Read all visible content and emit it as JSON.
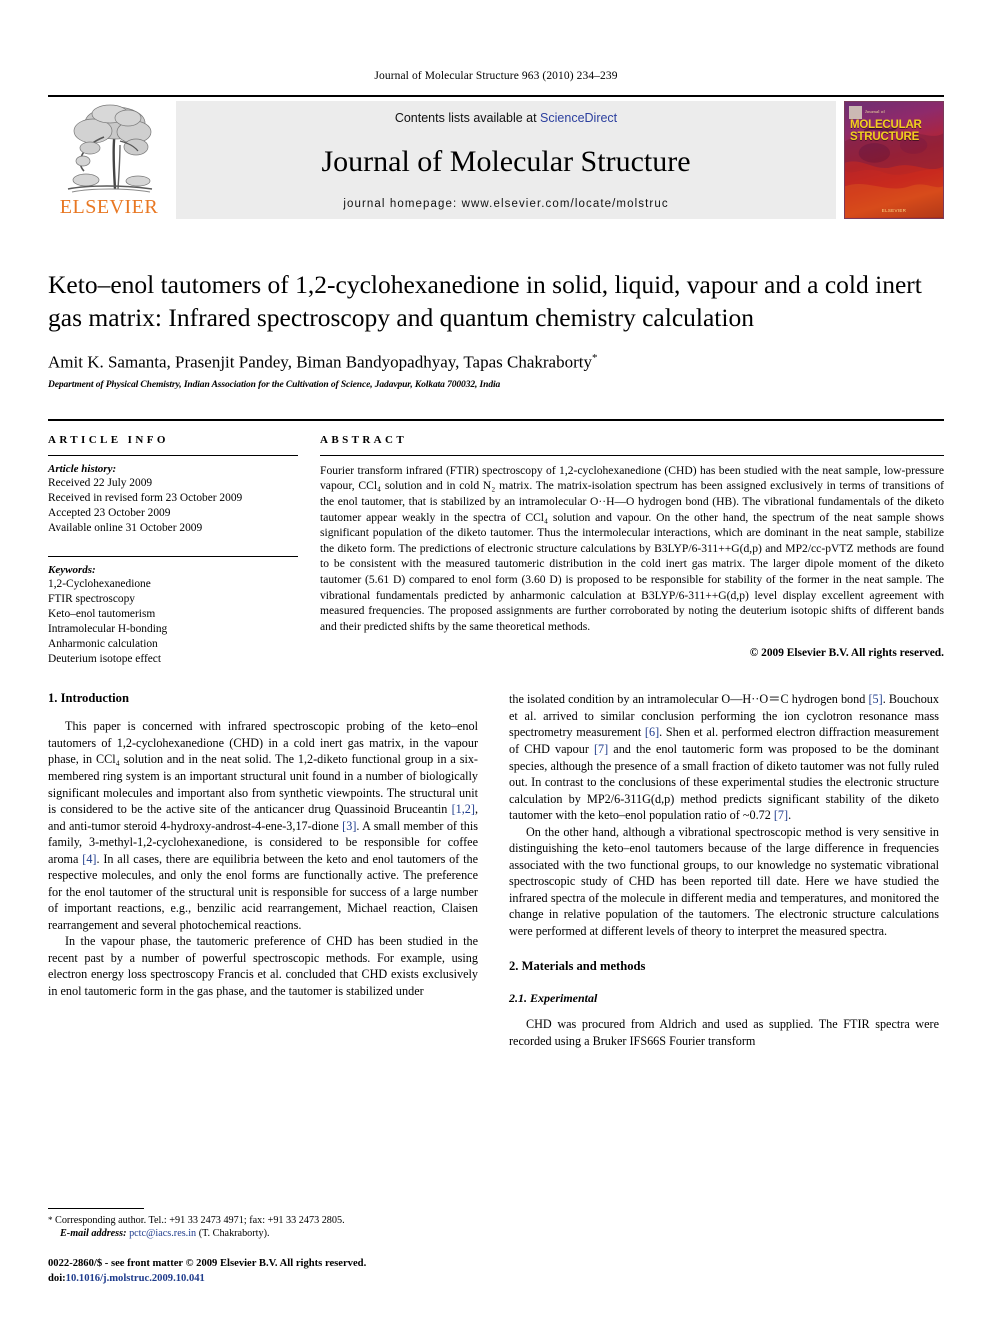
{
  "running_head": "Journal of Molecular Structure 963 (2010) 234–239",
  "masthead": {
    "contents_prefix": "Contents lists available at ",
    "sciencedirect": "ScienceDirect",
    "journal_title": "Journal of Molecular Structure",
    "homepage": "journal homepage: www.elsevier.com/locate/molstruc",
    "publisher_logo_text": "ELSEVIER",
    "cover": {
      "top_label": "Journal of",
      "title_line1": "MOLECULAR",
      "title_line2": "STRUCTURE",
      "bottom_label": "ELSEVIER"
    },
    "link_color": "#2b3f9e",
    "brand_color": "#E87722"
  },
  "article": {
    "title": "Keto–enol tautomers of 1,2-cyclohexanedione in solid, liquid, vapour and a cold inert gas matrix: Infrared spectroscopy and quantum chemistry calculation",
    "authors": "Amit K. Samanta, Prasenjit Pandey, Biman Bandyopadhyay, Tapas Chakraborty",
    "author_marker": "*",
    "affiliation": "Department of Physical Chemistry, Indian Association for the Cultivation of Science, Jadavpur, Kolkata 700032, India"
  },
  "article_info": {
    "heading": "ARTICLE INFO",
    "history_label": "Article history:",
    "history": [
      "Received 22 July 2009",
      "Received in revised form 23 October 2009",
      "Accepted 23 October 2009",
      "Available online 31 October 2009"
    ],
    "keywords_label": "Keywords:",
    "keywords": [
      "1,2-Cyclohexanedione",
      "FTIR spectroscopy",
      "Keto–enol tautomerism",
      "Intramolecular H-bonding",
      "Anharmonic calculation",
      "Deuterium isotope effect"
    ]
  },
  "abstract": {
    "heading": "ABSTRACT",
    "text": "Fourier transform infrared (FTIR) spectroscopy of 1,2-cyclohexanedione (CHD) has been studied with the neat sample, low-pressure vapour, CCl₄ solution and in cold N₂ matrix. The matrix-isolation spectrum has been assigned exclusively in terms of transitions of the enol tautomer, that is stabilized by an intramolecular O··H—O hydrogen bond (HB). The vibrational fundamentals of the diketo tautomer appear weakly in the spectra of CCl₄ solution and vapour. On the other hand, the spectrum of the neat sample shows significant population of the diketo tautomer. Thus the intermolecular interactions, which are dominant in the neat sample, stabilize the diketo form. The predictions of electronic structure calculations by B3LYP/6-311++G(d,p) and MP2/cc-pVTZ methods are found to be consistent with the measured tautomeric distribution in the cold inert gas matrix. The larger dipole moment of the diketo tautomer (5.61 D) compared to enol form (3.60 D) is proposed to be responsible for stability of the former in the neat sample. The vibrational fundamentals predicted by anharmonic calculation at B3LYP/6-311++G(d,p) level display excellent agreement with measured frequencies. The proposed assignments are further corroborated by noting the deuterium isotopic shifts of different bands and their predicted shifts by the same theoretical methods.",
    "copyright": "© 2009 Elsevier B.V. All rights reserved."
  },
  "body": {
    "intro_heading": "1. Introduction",
    "intro_p1_a": "This paper is concerned with infrared spectroscopic probing of the keto–enol tautomers of 1,2-cyclohexanedione (CHD) in a cold inert gas matrix, in the vapour phase, in CCl₄ solution and in the neat solid. The 1,2-diketo functional group in a six-membered ring system is an important structural unit found in a number of biologically significant molecules and important also from synthetic viewpoints. The structural unit is considered to be the active site of the anticancer drug Quassinoid Bruceantin ",
    "intro_cite_12": "[1,2]",
    "intro_p1_b": ", and anti-tumor steroid 4-hydroxy-androst-4-ene-3,17-dione ",
    "intro_cite_3": "[3]",
    "intro_p1_c": ". A small member of this family, 3-methyl-1,2-cyclohexanedione, is considered to be responsible for coffee aroma ",
    "intro_cite_4": "[4]",
    "intro_p1_d": ". In all cases, there are equilibria between the keto and enol tautomers of the respective molecules, and only the enol forms are functionally active. The preference for the enol tautomer of the structural unit is responsible for success of a large number of important reactions, e.g., benzilic acid rearrangement, Michael reaction, Claisen rearrangement and several photochemical reactions.",
    "intro_p2": "In the vapour phase, the tautomeric preference of CHD has been studied in the recent past by a number of powerful spectroscopic methods. For example, using electron energy loss spectroscopy Francis et al. concluded that CHD exists exclusively in enol tautomeric form in the gas phase, and the tautomer is stabilized under",
    "right_p1_a": "the isolated condition by an intramolecular O—H··O＝C hydrogen bond ",
    "right_cite_5": "[5]",
    "right_p1_b": ". Bouchoux et al. arrived to similar conclusion performing the ion cyclotron resonance mass spectrometry measurement ",
    "right_cite_6": "[6]",
    "right_p1_c": ". Shen et al. performed electron diffraction measurement of CHD vapour ",
    "right_cite_7": "[7]",
    "right_p1_d": " and the enol tautomeric form was proposed to be the dominant species, although the presence of a small fraction of diketo tautomer was not fully ruled out. In contrast to the conclusions of these experimental studies the electronic structure calculation by MP2/6-311G(d,p) method predicts significant stability of the diketo tautomer with the keto–enol population ratio of ~0.72 ",
    "right_cite_7b": "[7]",
    "right_p1_e": ".",
    "right_p2": "On the other hand, although a vibrational spectroscopic method is very sensitive in distinguishing the keto–enol tautomers because of the large difference in frequencies associated with the two functional groups, to our knowledge no systematic vibrational spectroscopic study of CHD has been reported till date. Here we have studied the infrared spectra of the molecule in different media and temperatures, and monitored the change in relative population of the tautomers. The electronic structure calculations were performed at different levels of theory to interpret the measured spectra.",
    "materials_heading": "2. Materials and methods",
    "experimental_heading": "2.1. Experimental",
    "experimental_p1": "CHD was procured from Aldrich and used as supplied. The FTIR spectra were recorded using a Bruker IFS66S Fourier transform"
  },
  "footer": {
    "corresponding_marker": "*",
    "corresponding": "Corresponding author. Tel.: +91 33 2473 4971; fax: +91 33 2473 2805.",
    "email_label": "E-mail address:",
    "email": "pctc@iacs.res.in",
    "email_suffix": "(T. Chakraborty).",
    "issn_line": "0022-2860/$ - see front matter © 2009 Elsevier B.V. All rights reserved.",
    "doi_label": "doi:",
    "doi": "10.1016/j.molstruc.2009.10.041"
  }
}
